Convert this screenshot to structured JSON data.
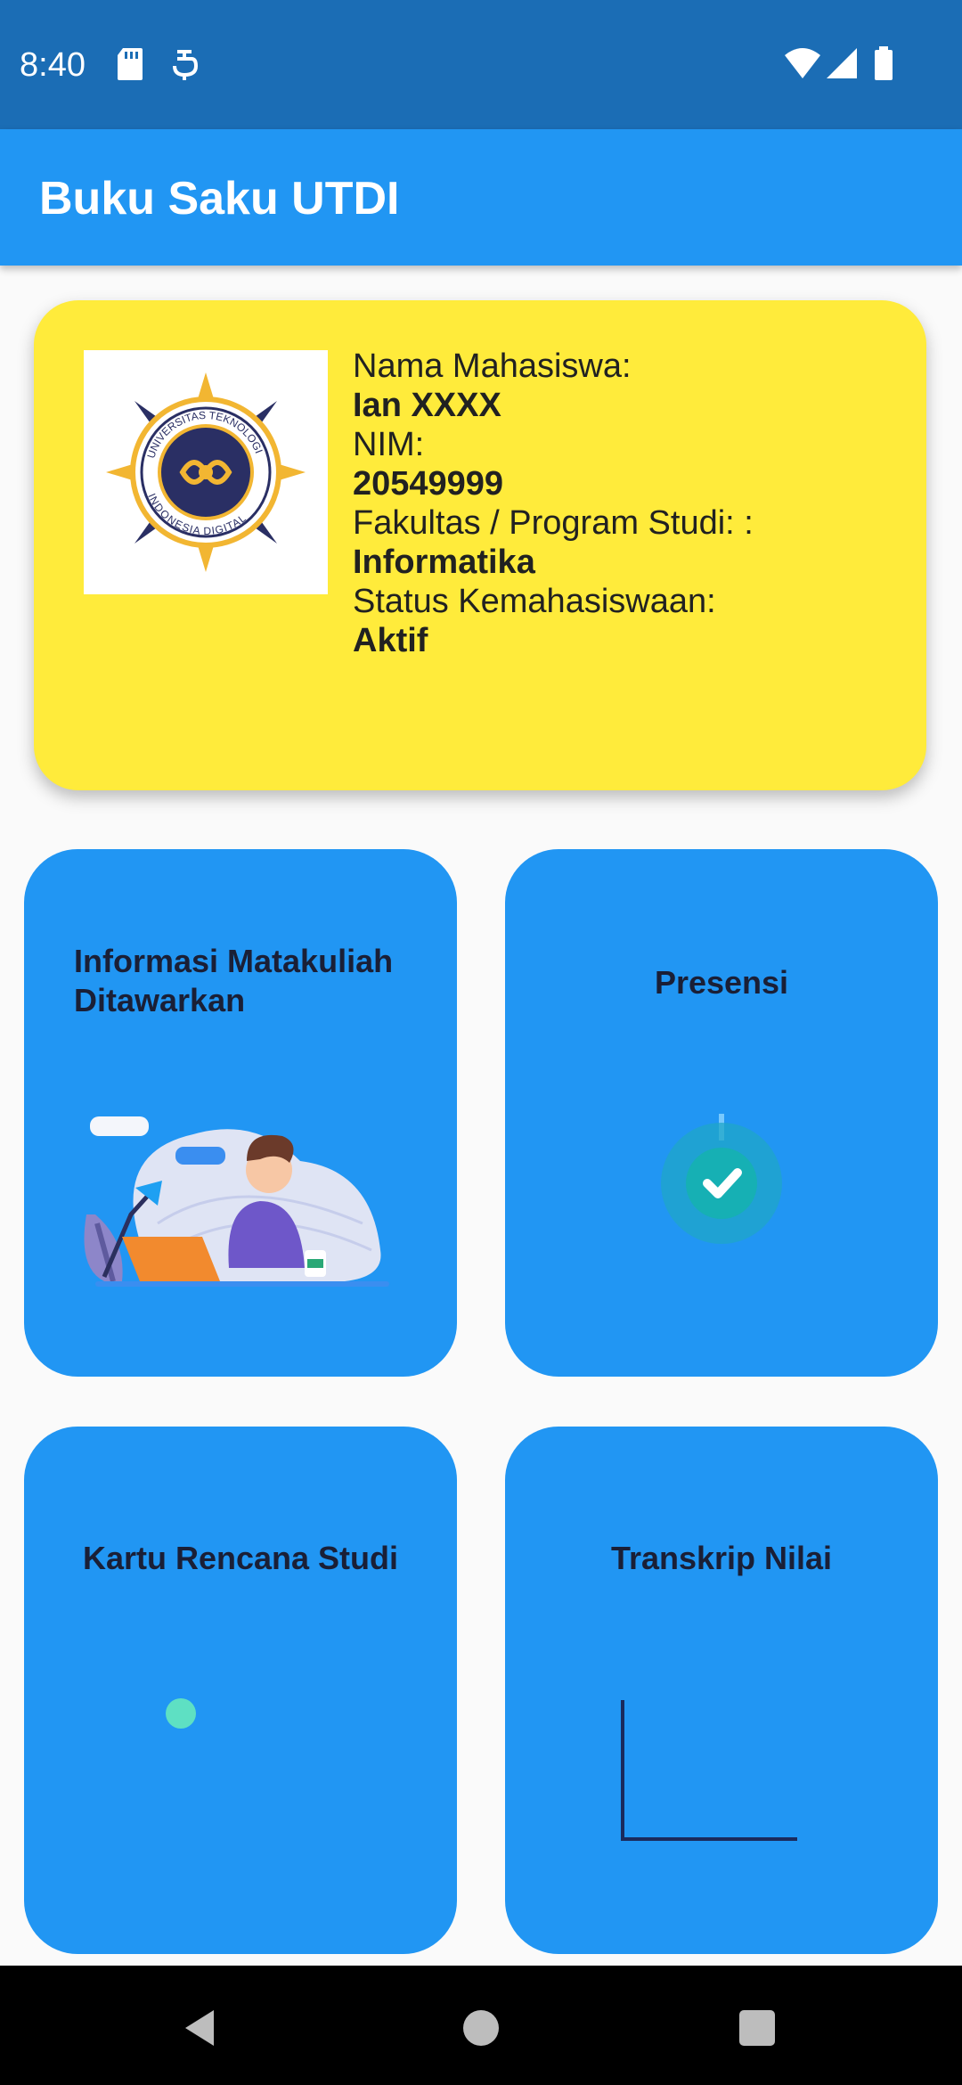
{
  "status_bar": {
    "time": "8:40",
    "icons": [
      "sd-card-icon",
      "sync-icon",
      "wifi-icon",
      "signal-icon",
      "battery-icon"
    ]
  },
  "app_bar": {
    "title": "Buku Saku UTDI"
  },
  "student": {
    "name_label": "Nama Mahasiswa:",
    "name": "Ian XXXX",
    "nim_label": "NIM:",
    "nim": "20549999",
    "faculty_label": "Fakultas / Program Studi: :",
    "faculty": "Informatika",
    "status_label": "Status Kemahasiswaan:",
    "status": "Aktif",
    "logo_text_top": "UNIVERSITAS TEKNOLOGI",
    "logo_text_bottom": "INDONESIA DIGITAL"
  },
  "menu": [
    {
      "title_line1": "Informasi Matakuliah",
      "title_line2": "Ditawarkan",
      "illustration": "person-laptop-illustration"
    },
    {
      "title": "Presensi",
      "illustration": "check-circle-icon"
    },
    {
      "title": "Kartu Rencana Studi",
      "illustration": "dot-animation"
    },
    {
      "title": "Transkrip Nilai",
      "illustration": "chart-axes-animation"
    }
  ],
  "colors": {
    "status_bar": "#1b6db5",
    "app_bar": "#2196f3",
    "card": "#ffeb3b",
    "tile": "#2196f3",
    "tile_text": "#1a1f36",
    "background": "#fafafa"
  },
  "nav_bar": {
    "icons": [
      "back-icon",
      "home-icon",
      "recents-icon"
    ]
  }
}
